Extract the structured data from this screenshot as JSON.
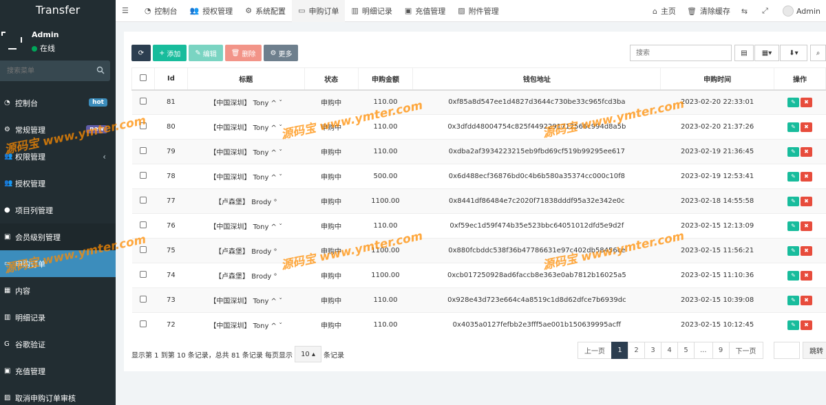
{
  "app": {
    "logo": "Transfer"
  },
  "user": {
    "name": "Admin",
    "status": "在线"
  },
  "sidebar": {
    "search_placeholder": "搜索菜单",
    "items": [
      {
        "label": "控制台",
        "icon": "dashboard-icon",
        "badge": "hot",
        "badge_color": "#3c8dbc"
      },
      {
        "label": "常规管理",
        "icon": "gears-icon",
        "badge": "new",
        "badge_color": "#605ca8"
      },
      {
        "label": "权限管理",
        "icon": "group-icon",
        "chevron": "‹"
      },
      {
        "label": "授权管理",
        "icon": "users-icon"
      },
      {
        "label": "项目列管理",
        "icon": "circle-icon"
      },
      {
        "label": "会员级别管理",
        "icon": "calendar-check-icon"
      },
      {
        "label": "申购订单",
        "icon": "card-icon",
        "active": true
      },
      {
        "label": "内容",
        "icon": "grid-icon"
      },
      {
        "label": "明细记录",
        "icon": "chart-icon"
      },
      {
        "label": "谷歌验证",
        "icon": "google-icon"
      },
      {
        "label": "充值管理",
        "icon": "calendar-icon"
      },
      {
        "label": "取消申购订单审核",
        "icon": "file-image-icon"
      }
    ]
  },
  "topnav": {
    "tabs": [
      {
        "label": "控制台",
        "icon": "dashboard-icon"
      },
      {
        "label": "授权管理",
        "icon": "users-icon"
      },
      {
        "label": "系统配置",
        "icon": "gear-icon"
      },
      {
        "label": "申购订单",
        "icon": "card-icon",
        "active": true
      },
      {
        "label": "明细记录",
        "icon": "chart-icon"
      },
      {
        "label": "充值管理",
        "icon": "calendar-icon"
      },
      {
        "label": "附件管理",
        "icon": "image-icon"
      }
    ],
    "right": {
      "home": "主页",
      "clear_cache": "清除缓存",
      "admin": "Admin"
    }
  },
  "toolbar": {
    "add": "添加",
    "edit": "编辑",
    "delete": "删除",
    "more": "更多",
    "search_placeholder": "搜索"
  },
  "table": {
    "columns": [
      "Id",
      "标题",
      "状态",
      "申购金额",
      "钱包地址",
      "申购时间",
      "操作"
    ],
    "rows": [
      {
        "id": "81",
        "title": "【中国深圳】 Tony ^ ˇ",
        "status": "申购中",
        "amount": "110.00",
        "wallet": "0xf85a8d547ee1d4827d3644c730be33c965fcd3ba",
        "time": "2023-02-20 22:33:01"
      },
      {
        "id": "80",
        "title": "【中国深圳】 Tony ^ ˇ",
        "status": "申购中",
        "amount": "110.00",
        "wallet": "0x3dfdd48004754c825f4492291712566c994d8a5b",
        "time": "2023-02-20 21:37:26"
      },
      {
        "id": "79",
        "title": "【中国深圳】 Tony ^ ˇ",
        "status": "申购中",
        "amount": "110.00",
        "wallet": "0xdba2af3934223215eb9fbd69cf519b99295ee617",
        "time": "2023-02-19 21:36:45"
      },
      {
        "id": "78",
        "title": "【中国深圳】 Tony ^ ˇ",
        "status": "申购中",
        "amount": "500.00",
        "wallet": "0x6d488ecf36876bd0c4b6b580a35374cc000c10f8",
        "time": "2023-02-19 12:53:41"
      },
      {
        "id": "77",
        "title": "【卢森堡】 Brody °",
        "status": "申购中",
        "amount": "1100.00",
        "wallet": "0x8441df86484e7c2020f71838dddf95a32e342e0c",
        "time": "2023-02-18 14:55:58"
      },
      {
        "id": "76",
        "title": "【中国深圳】 Tony ^ ˇ",
        "status": "申购中",
        "amount": "110.00",
        "wallet": "0xf59ec1d59f474b35e523bbc64051012dfd5e9d2f",
        "time": "2023-02-15 12:13:09"
      },
      {
        "id": "75",
        "title": "【卢森堡】 Brody °",
        "status": "申购中",
        "amount": "1100.00",
        "wallet": "0x880fcbddc538f36b47786631e97c402db58456ce",
        "time": "2023-02-15 11:56:21"
      },
      {
        "id": "74",
        "title": "【卢森堡】 Brody °",
        "status": "申购中",
        "amount": "1100.00",
        "wallet": "0xcb017250928ad6faccb8e363e0ab7812b16025a5",
        "time": "2023-02-15 11:10:36"
      },
      {
        "id": "73",
        "title": "【中国深圳】 Tony ^ ˇ",
        "status": "申购中",
        "amount": "110.00",
        "wallet": "0x928e43d723e664c4a8519c1d8d62dfce7b6939dc",
        "time": "2023-02-15 10:39:08"
      },
      {
        "id": "72",
        "title": "【中国深圳】 Tony ^ ˇ",
        "status": "申购中",
        "amount": "110.00",
        "wallet": "0x4035a0127fefbb2e3fff5ae001b150639995acff",
        "time": "2023-02-15 10:12:45"
      }
    ]
  },
  "footer": {
    "info": "显示第 1 到第 10 条记录，总共 81 条记录 每页显示",
    "page_size": "10",
    "suffix": "条记录",
    "pages": [
      "上一页",
      "1",
      "2",
      "3",
      "4",
      "5",
      "...",
      "9",
      "下一页"
    ],
    "current_page": "1",
    "jump": "跳转"
  },
  "watermark": "源码宝 www.ymter.com",
  "colors": {
    "sidebar_bg": "#222d32",
    "active": "#3c8dbc",
    "add": "#18bc9c",
    "delete": "#e74c3c",
    "primary": "#2c3e50"
  }
}
